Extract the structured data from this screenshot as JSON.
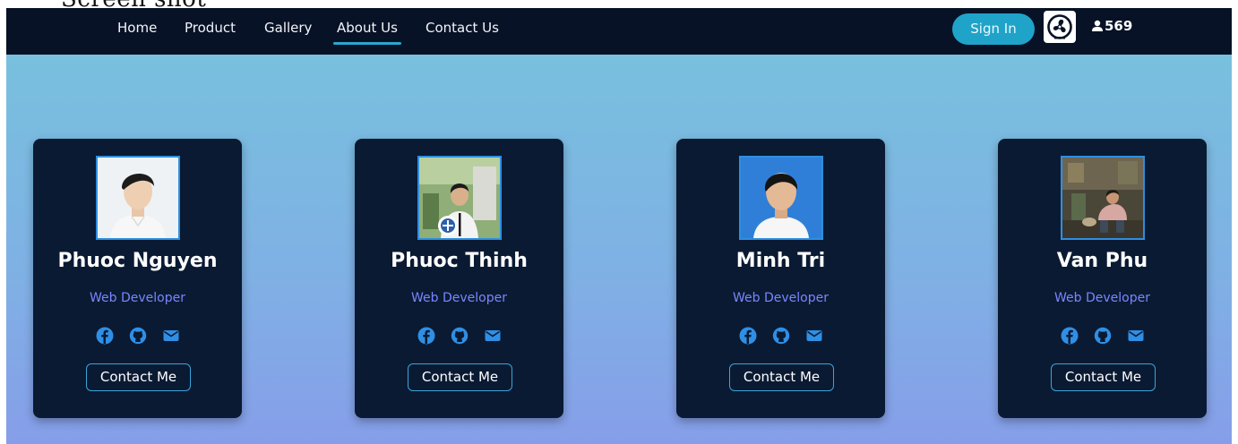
{
  "caption": "Screen shot",
  "nav": {
    "links": [
      "Home",
      "Product",
      "Gallery",
      "About Us",
      "Contact Us"
    ],
    "active": "About Us",
    "signin_label": "Sign In",
    "visitor_count": "569"
  },
  "cards": [
    {
      "name": "Phuoc Nguyen",
      "role": "Web Developer",
      "contact_label": "Contact Me"
    },
    {
      "name": "Phuoc Thinh",
      "role": "Web Developer",
      "contact_label": "Contact Me"
    },
    {
      "name": "Minh Tri",
      "role": "Web Developer",
      "contact_label": "Contact Me"
    },
    {
      "name": "Van Phu",
      "role": "Web Developer",
      "contact_label": "Contact Me"
    }
  ],
  "icons": [
    "fan-logo-icon",
    "user-icon",
    "facebook-icon",
    "github-icon",
    "envelope-icon"
  ],
  "colors": {
    "navbar": "#071226",
    "accent": "#1fa3c9",
    "card": "#0a1a33",
    "role_text": "#7a86ff",
    "hero_top": "#78c0de",
    "hero_bottom": "#869ee9"
  }
}
